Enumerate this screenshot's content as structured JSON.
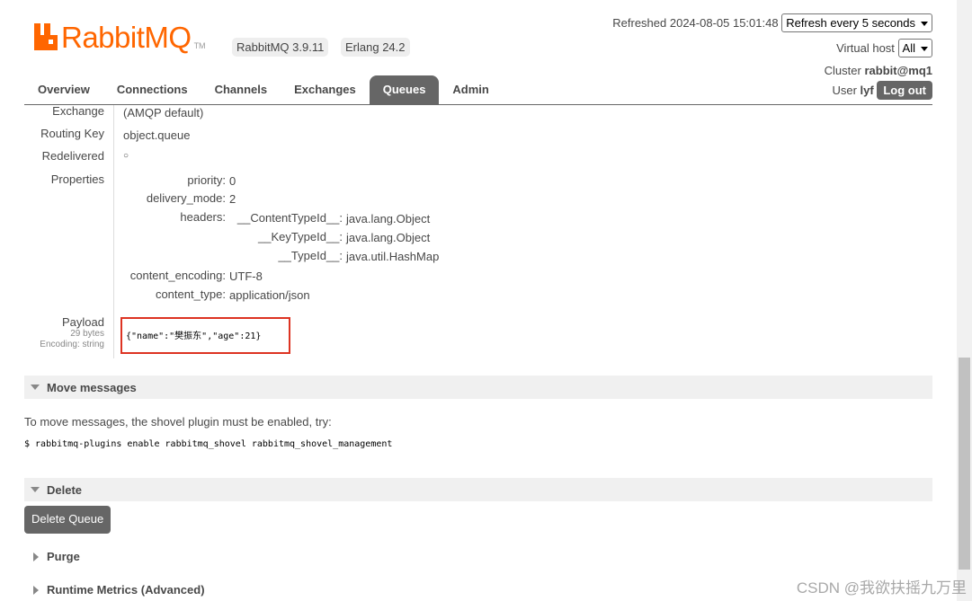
{
  "header": {
    "logo_text": "RabbitMQ",
    "logo_tm": "TM",
    "version_badge": "RabbitMQ 3.9.11",
    "erlang_badge": "Erlang 24.2",
    "refreshed_label": "Refreshed 2024-08-05 15:01:48",
    "refresh_select": "Refresh every 5 seconds",
    "vhost_label": "Virtual host",
    "vhost_select": "All",
    "cluster_label": "Cluster",
    "cluster_name": "rabbit@mq1",
    "user_label": "User",
    "user_name": "lyf",
    "logout_label": "Log out"
  },
  "tabs": [
    {
      "label": "Overview"
    },
    {
      "label": "Connections"
    },
    {
      "label": "Channels"
    },
    {
      "label": "Exchanges"
    },
    {
      "label": "Queues"
    },
    {
      "label": "Admin"
    }
  ],
  "active_tab": "Queues",
  "message": {
    "exchange_label": "Exchange",
    "exchange_value": "(AMQP default)",
    "routing_key_label": "Routing Key",
    "routing_key_value": "object.queue",
    "redelivered_label": "Redelivered",
    "redelivered_value": "○",
    "properties_label": "Properties",
    "properties": {
      "priority_key": "priority:",
      "priority_val": "0",
      "delivery_mode_key": "delivery_mode:",
      "delivery_mode_val": "2",
      "headers_key": "headers:",
      "h1_key": "__ContentTypeId__:",
      "h1_val": "java.lang.Object",
      "h2_key": "__KeyTypeId__:",
      "h2_val": "java.lang.Object",
      "h3_key": "__TypeId__:",
      "h3_val": "java.util.HashMap",
      "content_encoding_key": "content_encoding:",
      "content_encoding_val": "UTF-8",
      "content_type_key": "content_type:",
      "content_type_val": "application/json"
    },
    "payload_label": "Payload",
    "payload_bytes": "29 bytes",
    "payload_encoding": "Encoding: string",
    "payload_value": "{\"name\":\"樊振东\",\"age\":21}"
  },
  "move_messages": {
    "title": "Move messages",
    "text": "To move messages, the shovel plugin must be enabled, try:",
    "command": "$ rabbitmq-plugins enable rabbitmq_shovel rabbitmq_shovel_management"
  },
  "delete": {
    "title": "Delete",
    "button": "Delete Queue"
  },
  "purge": {
    "title": "Purge"
  },
  "runtime_metrics": {
    "title": "Runtime Metrics (Advanced)"
  },
  "watermark": "CSDN @我欲扶摇九万里",
  "colors": {
    "brand": "#ff6600",
    "tab_active": "#666666",
    "highlight_box": "#dd3322"
  }
}
